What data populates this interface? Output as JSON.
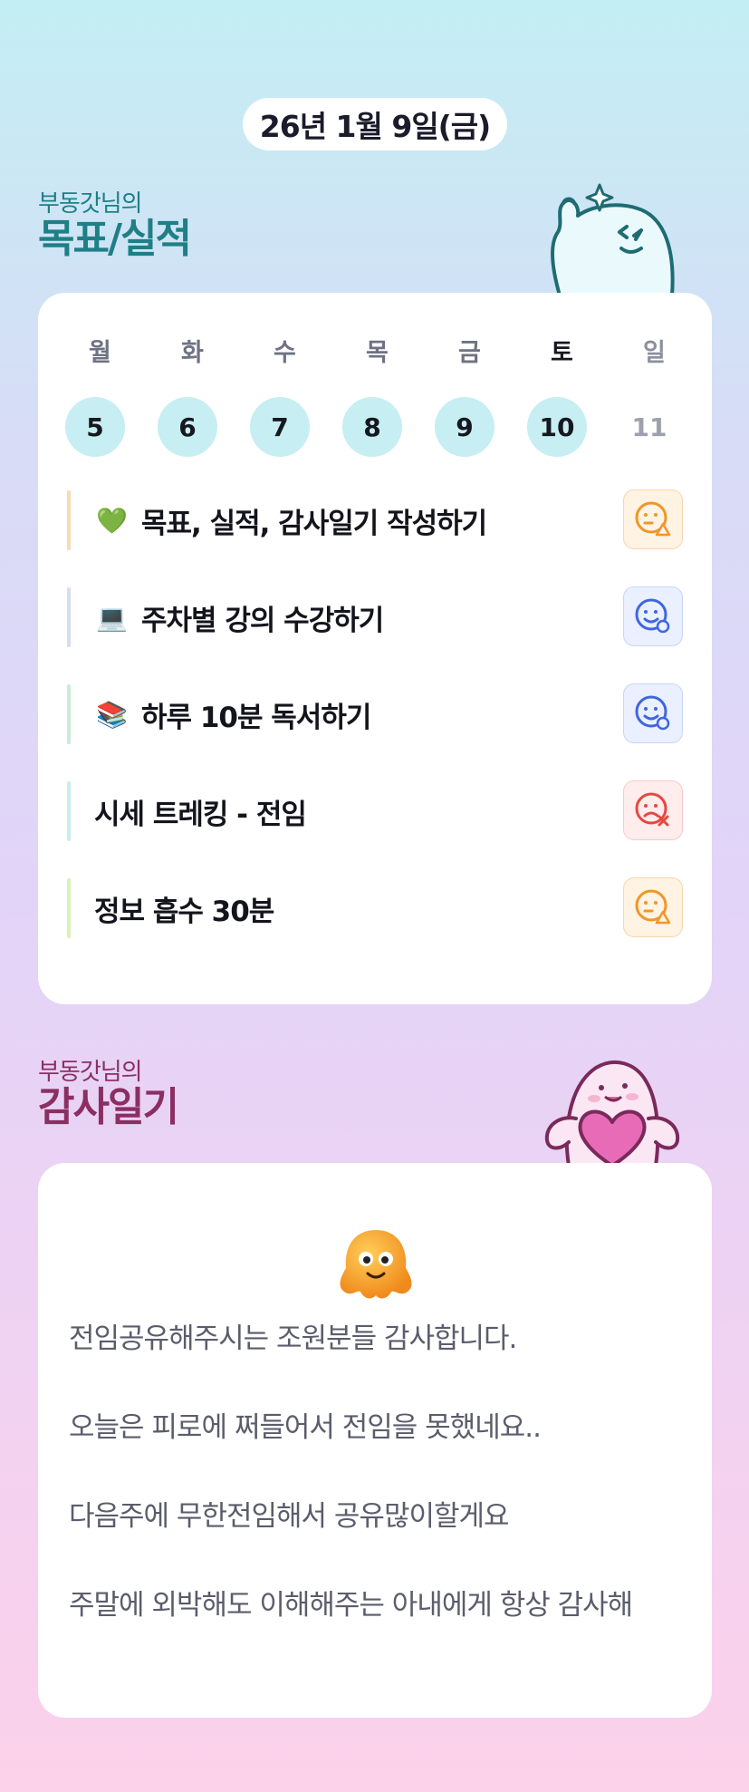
{
  "date": "26년 1월 9일(금)",
  "goal_section": {
    "subtitle": "부동갓님의",
    "title": "목표/실적"
  },
  "week": {
    "weekdays": [
      "월",
      "화",
      "수",
      "목",
      "금",
      "토",
      "일"
    ],
    "days": [
      "5",
      "6",
      "7",
      "8",
      "9",
      "10",
      "11"
    ]
  },
  "tasks": [
    {
      "emoji": "💚",
      "label": "목표, 실적, 감사일기 작성하기",
      "bar_color": "#f6dcb6",
      "status": "partial",
      "status_icon": "face-triangle-icon"
    },
    {
      "emoji": "💻",
      "label": "주차별 강의 수강하기",
      "bar_color": "#d7ddf0",
      "status": "done",
      "status_icon": "face-circle-icon"
    },
    {
      "emoji": "📚",
      "label": "하루 10분 독서하기",
      "bar_color": "#c9ecd9",
      "status": "done",
      "status_icon": "face-circle-icon"
    },
    {
      "emoji": "",
      "label": "시세 트레킹 - 전임",
      "bar_color": "#c9ecf0",
      "status": "fail",
      "status_icon": "face-x-icon"
    },
    {
      "emoji": "",
      "label": "정보 흡수 30분",
      "bar_color": "#dcf0b8",
      "status": "partial",
      "status_icon": "face-triangle-icon"
    }
  ],
  "thanks_section": {
    "subtitle": "부동갓님의",
    "title": "감사일기"
  },
  "diary": [
    "전임공유해주시는 조원분들 감사합니다.",
    "오늘은 피로에 쩌들어서 전임을 못했네요..",
    "다음주에 무한전임해서 공유많이할게요",
    "주말에 외박해도 이해해주는 아내에게 항상 감사해"
  ],
  "colors": {
    "teal_title": "#1f7f86",
    "plum_title": "#8b2f63",
    "warn": "#f0962a",
    "good": "#3f66e0",
    "bad": "#e5483f"
  }
}
